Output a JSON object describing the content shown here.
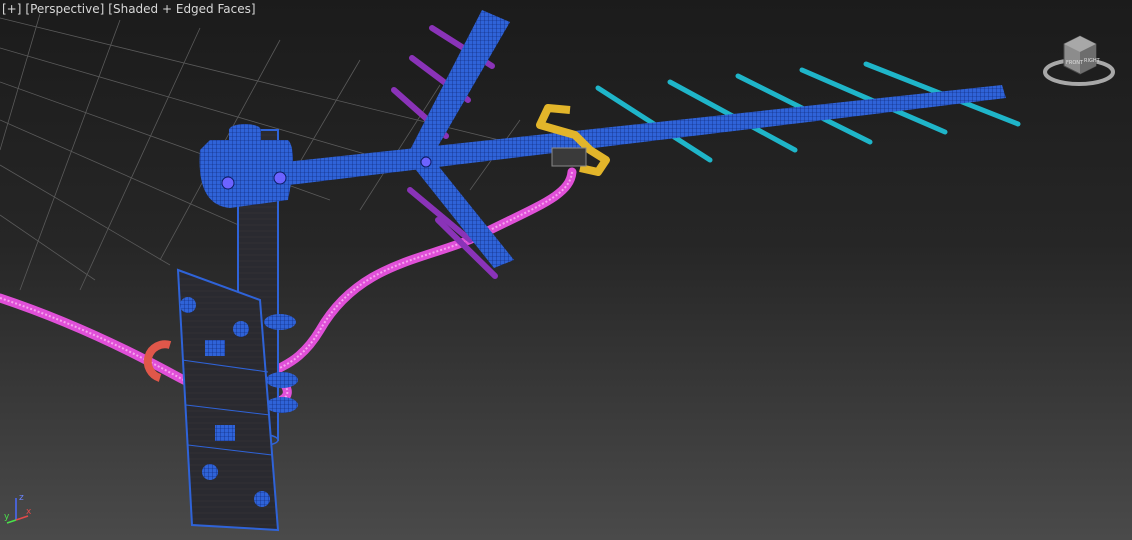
{
  "viewport": {
    "labels": [
      {
        "id": "menu",
        "text": "[+]"
      },
      {
        "id": "pov",
        "text": "[Perspective]"
      },
      {
        "id": "shading",
        "text": "[Shaded + Edged Faces]"
      }
    ]
  },
  "viewcube": {
    "face_left": "FRONT",
    "face_right": "RIGHT"
  },
  "axis_tripod": {
    "z": "z",
    "x": "x",
    "y": "y"
  },
  "colors": {
    "boom": "#2f63d8",
    "elements_purple": "#8a33b8",
    "directors_cyan": "#1fb5c9",
    "cable_pink": "#e050d8",
    "clamp_red": "#e0574a",
    "bracket_yellow": "#e2b52a",
    "plate": "#2a2a30"
  }
}
